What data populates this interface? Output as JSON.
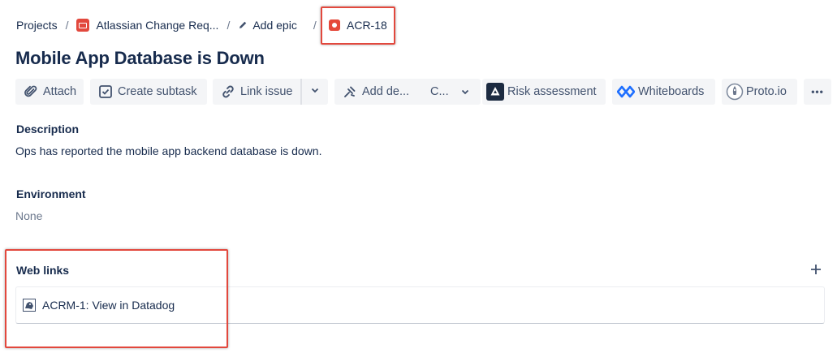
{
  "breadcrumb": {
    "projects": "Projects",
    "separator": "/",
    "project_name": "Atlassian Change Req...",
    "add_epic": "Add epic",
    "issue_key": "ACR-18"
  },
  "issue": {
    "title": "Mobile App Database is Down"
  },
  "toolbar": {
    "attach": "Attach",
    "create_subtask": "Create subtask",
    "link_issue": "Link issue",
    "add_deployment": "Add de...",
    "c_menu": "C...",
    "risk_assessment": "Risk assessment",
    "whiteboards": "Whiteboards",
    "proto_io": "Proto.io",
    "more": "•••"
  },
  "description": {
    "label": "Description",
    "text": "Ops has reported the mobile app backend database is down."
  },
  "environment": {
    "label": "Environment",
    "value": "None"
  },
  "web_links": {
    "label": "Web links",
    "items": [
      {
        "text": "ACRM-1: View in Datadog",
        "icon": "datadog-icon"
      }
    ]
  },
  "colors": {
    "highlight": "#e2483d",
    "text": "#172b4d",
    "button_bg": "#f4f5f7",
    "whiteboards_blue": "#1e6fff",
    "risk_icon_bg": "#1c2b41"
  }
}
